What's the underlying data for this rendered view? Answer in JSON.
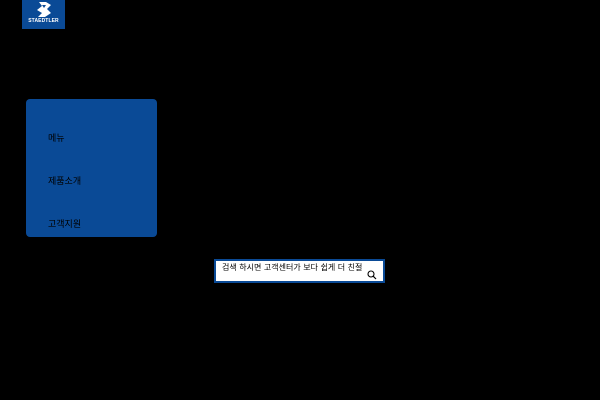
{
  "logo": {
    "text": "STAEDTLER"
  },
  "menu": {
    "items": [
      {
        "label": "메뉴"
      },
      {
        "label": "제품소개"
      },
      {
        "label": "고객지원"
      }
    ]
  },
  "search": {
    "value": "검색 하시면 고객센터가 보다 쉽게 더 친절하게"
  },
  "colors": {
    "background": "#000000",
    "brand_blue": "#0a4a96",
    "search_bg": "#ffffff"
  },
  "icons": [
    "staedtler-logo-icon",
    "search-icon"
  ]
}
